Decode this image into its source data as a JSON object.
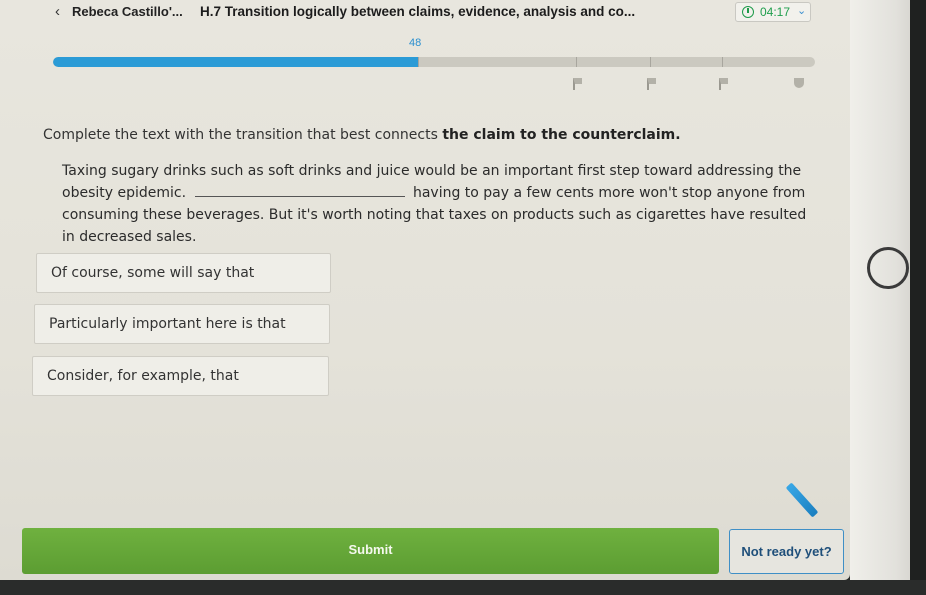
{
  "topbar": {
    "back_glyph": "‹",
    "student_name": "Rebeca Castillo'...",
    "skill_title": "H.7 Transition logically between claims, evidence, analysis and co...",
    "timer": "04:17",
    "timer_chevron": "⌄"
  },
  "progress": {
    "count": "48",
    "fraction": 0.48
  },
  "question": {
    "prompt_start": "Complete the text with the transition that best connects ",
    "prompt_bold": "the claim to the counterclaim.",
    "passage_part1": "Taxing sugary drinks such as soft drinks and juice would be an important first step toward addressing the obesity epidemic.",
    "passage_part2": "having to pay a few cents more won't stop anyone from consuming these beverages. But it's worth noting that taxes on products such as cigarettes have resulted in decreased sales."
  },
  "choices": [
    "Of course, some will say that",
    "Particularly important here is that",
    "Consider, for example, that"
  ],
  "buttons": {
    "submit": "Submit",
    "not_ready": "Not ready yet?"
  },
  "colors": {
    "progress": "#2b9bd6",
    "submit": "#5fa035",
    "timer": "#1f9e4d"
  },
  "icons": {
    "back": "chevron-left-icon",
    "timer": "clock-icon",
    "pencil": "pencil-icon",
    "home": "home-button"
  }
}
